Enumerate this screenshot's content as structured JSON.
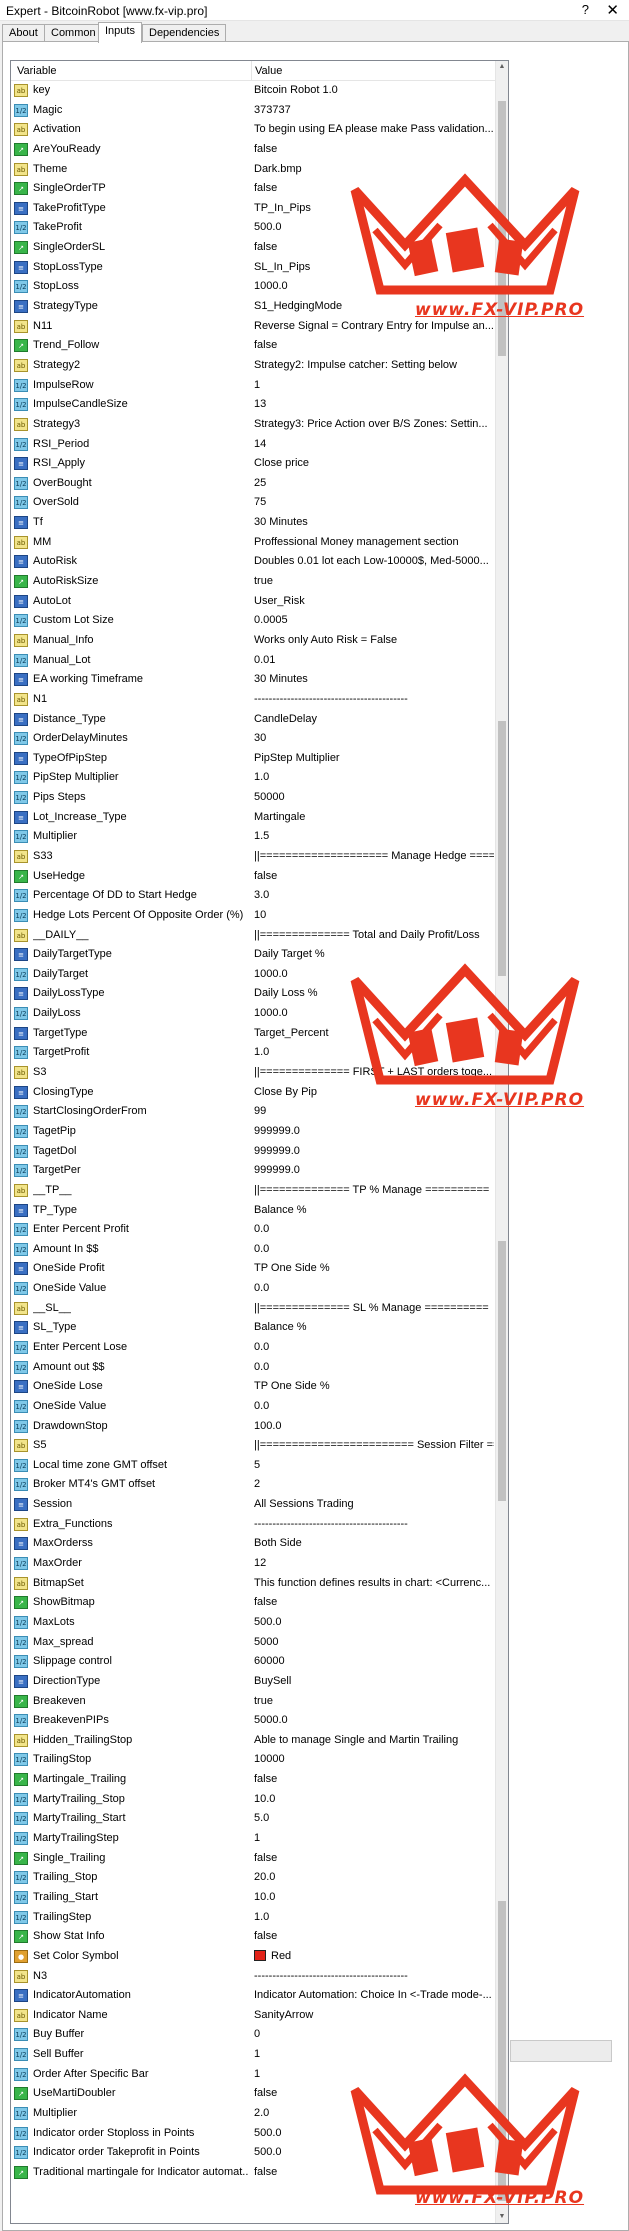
{
  "window": {
    "title": "Expert - BitcoinRobot [www.fx-vip.pro]",
    "help": "?",
    "close": "✕"
  },
  "tabs": [
    {
      "label": "About"
    },
    {
      "label": "Common"
    },
    {
      "label": "Inputs"
    },
    {
      "label": "Dependencies"
    }
  ],
  "active_tab": "Inputs",
  "columns": {
    "variable": "Variable",
    "value": "Value"
  },
  "watermark_text": "www.FX-VIP.PRO",
  "rows": [
    {
      "icon": "ab",
      "name": "key",
      "value": "Bitcoin Robot  1.0"
    },
    {
      "icon": "num",
      "name": "Magic",
      "value": "373737"
    },
    {
      "icon": "ab",
      "name": "Activation",
      "value": "To begin using EA please make Pass validation..."
    },
    {
      "icon": "bool",
      "name": "AreYouReady",
      "value": "false"
    },
    {
      "icon": "ab",
      "name": "Theme",
      "value": "Dark.bmp"
    },
    {
      "icon": "bool",
      "name": "SingleOrderTP",
      "value": "false"
    },
    {
      "icon": "enum",
      "name": "TakeProfitType",
      "value": "TP_In_Pips"
    },
    {
      "icon": "num",
      "name": "TakeProfit",
      "value": "500.0"
    },
    {
      "icon": "bool",
      "name": "SingleOrderSL",
      "value": "false"
    },
    {
      "icon": "enum",
      "name": "StopLossType",
      "value": "SL_In_Pips"
    },
    {
      "icon": "num",
      "name": "StopLoss",
      "value": "1000.0"
    },
    {
      "icon": "enum",
      "name": "StrategyType",
      "value": "S1_HedgingMode"
    },
    {
      "icon": "ab",
      "name": "N11",
      "value": "Reverse Signal  = Contrary Entry for Impulse an..."
    },
    {
      "icon": "bool",
      "name": "Trend_Follow",
      "value": "false"
    },
    {
      "icon": "ab",
      "name": "Strategy2",
      "value": "Strategy2: Impulse catcher: Setting below"
    },
    {
      "icon": "num",
      "name": "ImpulseRow",
      "value": "1"
    },
    {
      "icon": "num",
      "name": "ImpulseCandleSize",
      "value": "13"
    },
    {
      "icon": "ab",
      "name": "Strategy3",
      "value": "Strategy3: Price Action over B/S Zones: Settin..."
    },
    {
      "icon": "num",
      "name": "RSI_Period",
      "value": "14"
    },
    {
      "icon": "enum",
      "name": "RSI_Apply",
      "value": "Close price"
    },
    {
      "icon": "num",
      "name": "OverBought",
      "value": "25"
    },
    {
      "icon": "num",
      "name": "OverSold",
      "value": "75"
    },
    {
      "icon": "enum",
      "name": "Tf",
      "value": "30 Minutes"
    },
    {
      "icon": "ab",
      "name": "MM",
      "value": "Proffessional Money management section"
    },
    {
      "icon": "enum",
      "name": "AutoRisk",
      "value": "Doubles 0.01 lot each Low-10000$, Med-5000..."
    },
    {
      "icon": "bool",
      "name": "AutoRiskSize",
      "value": "true"
    },
    {
      "icon": "enum",
      "name": "AutoLot",
      "value": "User_Risk"
    },
    {
      "icon": "num",
      "name": "Custom Lot Size",
      "value": "0.0005"
    },
    {
      "icon": "ab",
      "name": "Manual_Info",
      "value": "Works only Auto Risk = False"
    },
    {
      "icon": "num",
      "name": "Manual_Lot",
      "value": "0.01"
    },
    {
      "icon": "enum",
      "name": "EA working Timeframe",
      "value": "30 Minutes"
    },
    {
      "icon": "ab",
      "name": "N1",
      "value": "------------------------------------------"
    },
    {
      "icon": "enum",
      "name": "Distance_Type",
      "value": "CandleDelay"
    },
    {
      "icon": "num",
      "name": "OrderDelayMinutes",
      "value": "30"
    },
    {
      "icon": "enum",
      "name": "TypeOfPipStep",
      "value": "PipStep Multiplier"
    },
    {
      "icon": "num",
      "name": "PipStep Multiplier",
      "value": "1.0"
    },
    {
      "icon": "num",
      "name": "Pips Steps",
      "value": "50000"
    },
    {
      "icon": "enum",
      "name": "Lot_Increase_Type",
      "value": "Martingale"
    },
    {
      "icon": "num",
      "name": "Multiplier",
      "value": "1.5"
    },
    {
      "icon": "ab",
      "name": "S33",
      "value": "||==================== Manage Hedge ===="
    },
    {
      "icon": "bool",
      "name": "UseHedge",
      "value": "false"
    },
    {
      "icon": "num",
      "name": "Percentage Of DD to Start Hedge",
      "value": "3.0"
    },
    {
      "icon": "num",
      "name": "Hedge Lots Percent Of Opposite Order (%)",
      "value": "10"
    },
    {
      "icon": "ab",
      "name": "__DAILY__",
      "value": "||============== Total and Daily Profit/Loss"
    },
    {
      "icon": "enum",
      "name": "DailyTargetType",
      "value": "Daily Target %"
    },
    {
      "icon": "num",
      "name": "DailyTarget",
      "value": "1000.0"
    },
    {
      "icon": "enum",
      "name": "DailyLossType",
      "value": "Daily Loss %"
    },
    {
      "icon": "num",
      "name": "DailyLoss",
      "value": "1000.0"
    },
    {
      "icon": "enum",
      "name": "TargetType",
      "value": "Target_Percent"
    },
    {
      "icon": "num",
      "name": "TargetProfit",
      "value": "1.0"
    },
    {
      "icon": "ab",
      "name": "S3",
      "value": "||============== FIRST + LAST orders toge..."
    },
    {
      "icon": "enum",
      "name": "ClosingType",
      "value": "Close By Pip"
    },
    {
      "icon": "num",
      "name": "StartClosingOrderFrom",
      "value": "99"
    },
    {
      "icon": "num",
      "name": "TagetPip",
      "value": "999999.0"
    },
    {
      "icon": "num",
      "name": "TagetDol",
      "value": "999999.0"
    },
    {
      "icon": "num",
      "name": "TargetPer",
      "value": "999999.0"
    },
    {
      "icon": "ab",
      "name": "__TP__",
      "value": "||============== TP % Manage =========="
    },
    {
      "icon": "enum",
      "name": "TP_Type",
      "value": "Balance %"
    },
    {
      "icon": "num",
      "name": "Enter Percent Profit",
      "value": "0.0"
    },
    {
      "icon": "num",
      "name": "Amount In $$",
      "value": "0.0"
    },
    {
      "icon": "enum",
      "name": "OneSide Profit",
      "value": "TP One Side %"
    },
    {
      "icon": "num",
      "name": "OneSide Value",
      "value": "0.0"
    },
    {
      "icon": "ab",
      "name": "__SL__",
      "value": "||============== SL % Manage =========="
    },
    {
      "icon": "enum",
      "name": "SL_Type",
      "value": "Balance %"
    },
    {
      "icon": "num",
      "name": "Enter Percent Lose",
      "value": "0.0"
    },
    {
      "icon": "num",
      "name": "Amount out $$",
      "value": "0.0"
    },
    {
      "icon": "enum",
      "name": "OneSide Lose",
      "value": "TP One Side %"
    },
    {
      "icon": "num",
      "name": "OneSide Value",
      "value": "0.0"
    },
    {
      "icon": "num",
      "name": "DrawdownStop",
      "value": "100.0"
    },
    {
      "icon": "ab",
      "name": "S5",
      "value": "||======================== Session Filter =="
    },
    {
      "icon": "num",
      "name": "Local time zone GMT offset",
      "value": "5"
    },
    {
      "icon": "num",
      "name": "Broker MT4's GMT offset",
      "value": "2"
    },
    {
      "icon": "enum",
      "name": "Session",
      "value": "All Sessions Trading"
    },
    {
      "icon": "ab",
      "name": "Extra_Functions",
      "value": "------------------------------------------"
    },
    {
      "icon": "enum",
      "name": "MaxOrderss",
      "value": "Both Side"
    },
    {
      "icon": "num",
      "name": "MaxOrder",
      "value": "12"
    },
    {
      "icon": "ab",
      "name": "BitmapSet",
      "value": "This function defines results in chart: <Currenc..."
    },
    {
      "icon": "bool",
      "name": "ShowBitmap",
      "value": "false"
    },
    {
      "icon": "num",
      "name": "MaxLots",
      "value": "500.0"
    },
    {
      "icon": "num",
      "name": "Max_spread",
      "value": "5000"
    },
    {
      "icon": "num",
      "name": "Slippage control",
      "value": "60000"
    },
    {
      "icon": "enum",
      "name": "DirectionType",
      "value": "BuySell"
    },
    {
      "icon": "bool",
      "name": "Breakeven",
      "value": "true"
    },
    {
      "icon": "num",
      "name": "BreakevenPIPs",
      "value": "5000.0"
    },
    {
      "icon": "ab",
      "name": "Hidden_TrailingStop",
      "value": "Able to manage Single and Martin Trailing"
    },
    {
      "icon": "num",
      "name": "TrailingStop",
      "value": "10000"
    },
    {
      "icon": "bool",
      "name": "Martingale_Trailing",
      "value": "false"
    },
    {
      "icon": "num",
      "name": "MartyTrailing_Stop",
      "value": "10.0"
    },
    {
      "icon": "num",
      "name": "MartyTrailing_Start",
      "value": "5.0"
    },
    {
      "icon": "num",
      "name": "MartyTrailingStep",
      "value": "1"
    },
    {
      "icon": "bool",
      "name": "Single_Trailing",
      "value": "false"
    },
    {
      "icon": "num",
      "name": "Trailing_Stop",
      "value": "20.0"
    },
    {
      "icon": "num",
      "name": "Trailing_Start",
      "value": "10.0"
    },
    {
      "icon": "num",
      "name": "TrailingStep",
      "value": "1.0"
    },
    {
      "icon": "bool",
      "name": "Show Stat Info",
      "value": "false"
    },
    {
      "icon": "clr",
      "name": "Set Color Symbol",
      "value": "Red",
      "color": "#e2231a"
    },
    {
      "icon": "ab",
      "name": "N3",
      "value": "------------------------------------------"
    },
    {
      "icon": "enum",
      "name": "IndicatorAutomation",
      "value": "Indicator Automation: Choice In <-Trade mode-..."
    },
    {
      "icon": "ab",
      "name": "Indicator Name",
      "value": "SanityArrow"
    },
    {
      "icon": "num",
      "name": "Buy Buffer",
      "value": "0"
    },
    {
      "icon": "num",
      "name": "Sell Buffer",
      "value": "1"
    },
    {
      "icon": "num",
      "name": "Order After Specific Bar",
      "value": "1"
    },
    {
      "icon": "bool",
      "name": "UseMartiDoubler",
      "value": "false"
    },
    {
      "icon": "num",
      "name": "Multiplier",
      "value": "2.0"
    },
    {
      "icon": "num",
      "name": "Indicator order Stoploss in Points",
      "value": "500.0"
    },
    {
      "icon": "num",
      "name": "Indicator order Takeprofit in Points",
      "value": "500.0"
    },
    {
      "icon": "bool",
      "name": "Traditional martingale for Indicator automat...",
      "value": "false"
    }
  ],
  "icon_labels": {
    "ab": "ab",
    "bool": "↗",
    "enum": "≡",
    "num": "1/2",
    "clr": "●"
  },
  "colors": {
    "selection": "#cce8ff",
    "watermark": "#e8361f",
    "swatch_red": "#e2231a"
  }
}
